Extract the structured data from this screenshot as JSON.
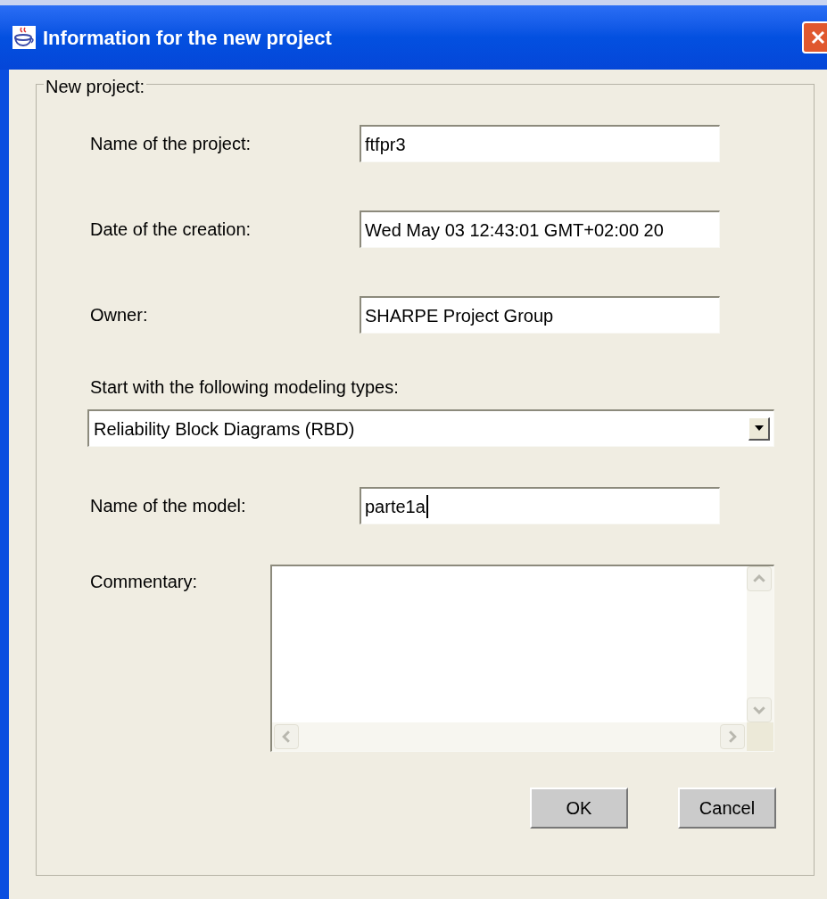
{
  "window": {
    "title": "Information for the new project"
  },
  "group": {
    "title": "New project:"
  },
  "fields": [
    {
      "kind": "text",
      "label": "Name of the project:",
      "value": "ftfpr3"
    },
    {
      "kind": "text",
      "label": "Date of the creation:",
      "value": "Wed May 03 12:43:01 GMT+02:00 20"
    },
    {
      "kind": "text",
      "label": "Owner:",
      "value": "SHARPE Project Group"
    },
    {
      "kind": "combo",
      "label": "Start with the following modeling types:",
      "value": "Reliability Block Diagrams (RBD)"
    },
    {
      "kind": "text",
      "label": "Name of the model:",
      "value": "parte1a",
      "focused": true
    },
    {
      "kind": "textarea",
      "label": "Commentary:"
    }
  ],
  "buttons": [
    "OK",
    "Cancel"
  ]
}
